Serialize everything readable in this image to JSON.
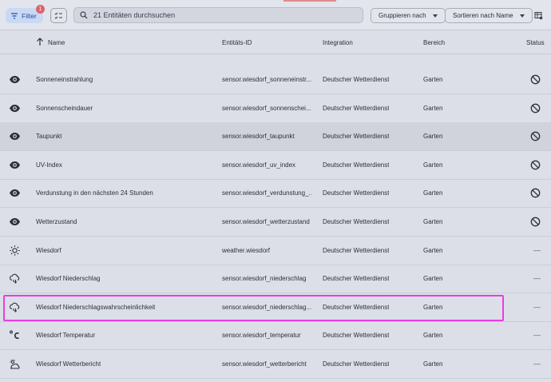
{
  "toolbar": {
    "filter_label": "Filter",
    "filter_badge": "1",
    "search_placeholder": "21 Entitäten durchsuchen",
    "group_label": "Gruppieren nach",
    "sort_label": "Sortieren nach Name"
  },
  "columns": {
    "name": "Name",
    "entity_id": "Entitäts-ID",
    "integration": "Integration",
    "area": "Bereich",
    "status": "Status"
  },
  "rows": [
    {
      "icon": "eye-icon",
      "name": "Sonneneinstrahlung",
      "entity_id": "sensor.wiesdorf_sonneneinstr...",
      "integration": "Deutscher Wetterdienst",
      "area": "Garten",
      "status": "disabled-icon"
    },
    {
      "icon": "eye-icon",
      "name": "Sonnenscheindauer",
      "entity_id": "sensor.wiesdorf_sonnenschei...",
      "integration": "Deutscher Wetterdienst",
      "area": "Garten",
      "status": "disabled-icon"
    },
    {
      "icon": "eye-icon",
      "name": "Taupunkt",
      "entity_id": "sensor.wiesdorf_taupunkt",
      "integration": "Deutscher Wetterdienst",
      "area": "Garten",
      "status": "disabled-icon"
    },
    {
      "icon": "eye-icon",
      "name": "UV-Index",
      "entity_id": "sensor.wiesdorf_uv_index",
      "integration": "Deutscher Wetterdienst",
      "area": "Garten",
      "status": "disabled-icon"
    },
    {
      "icon": "eye-icon",
      "name": "Verdunstung in den nächsten 24 Stunden",
      "entity_id": "sensor.wiesdorf_verdunstung_...",
      "integration": "Deutscher Wetterdienst",
      "area": "Garten",
      "status": "disabled-icon"
    },
    {
      "icon": "eye-icon",
      "name": "Wetterzustand",
      "entity_id": "sensor.wiesdorf_wetterzustand",
      "integration": "Deutscher Wetterdienst",
      "area": "Garten",
      "status": "disabled-icon"
    },
    {
      "icon": "sun-icon",
      "name": "Wiesdorf",
      "entity_id": "weather.wiesdorf",
      "integration": "Deutscher Wetterdienst",
      "area": "Garten",
      "status": "—"
    },
    {
      "icon": "cloud-rain-icon",
      "name": "Wiesdorf Niederschlag",
      "entity_id": "sensor.wiesdorf_niederschlag",
      "integration": "Deutscher Wetterdienst",
      "area": "Garten",
      "status": "—"
    },
    {
      "icon": "cloud-rain-icon",
      "name": "Wiesdorf Niederschlagswahrscheinlichkeit",
      "entity_id": "sensor.wiesdorf_niederschlag...",
      "integration": "Deutscher Wetterdienst",
      "area": "Garten",
      "status": "—"
    },
    {
      "icon": "celsius-icon",
      "glyph": "°C",
      "name": "Wiesdorf Temperatur",
      "entity_id": "sensor.wiesdorf_temperatur",
      "integration": "Deutscher Wetterdienst",
      "area": "Garten",
      "status": "—"
    },
    {
      "icon": "weather-partly-icon",
      "name": "Wiesdorf Wetterbericht",
      "entity_id": "sensor.wiesdorf_wetterbericht",
      "integration": "Deutscher Wetterdienst",
      "area": "Garten",
      "status": "—"
    }
  ],
  "colors": {
    "accent": "#2b4f9a",
    "highlight_box": "#e83ee0",
    "badge": "#d9646a"
  }
}
